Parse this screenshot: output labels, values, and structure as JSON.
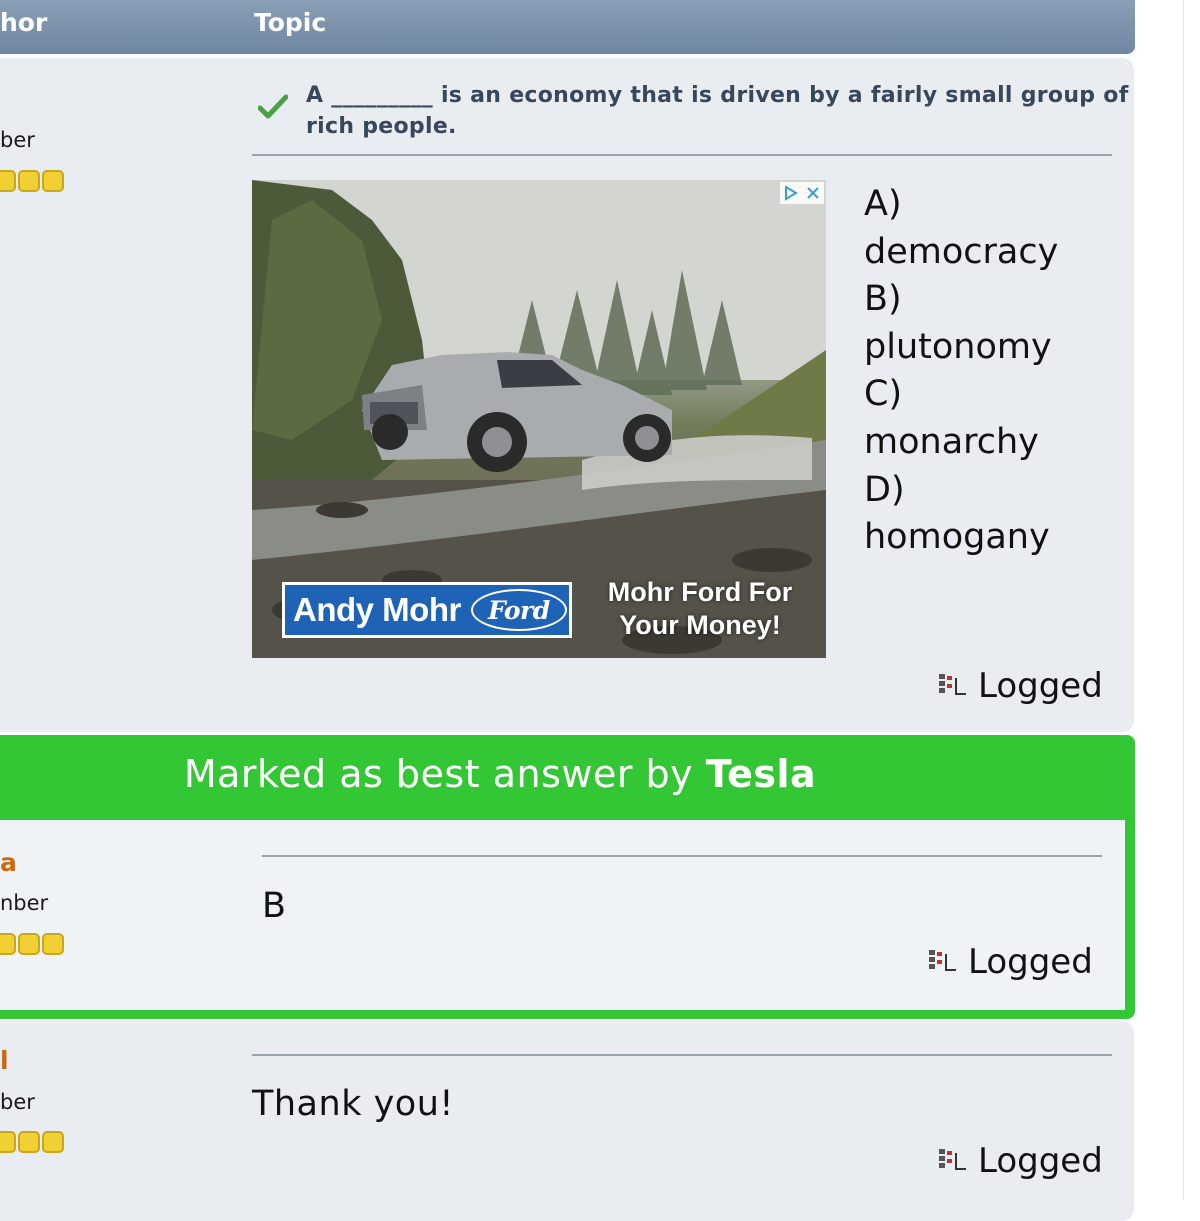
{
  "header": {
    "author_label": "hor",
    "topic_label": "Topic"
  },
  "post1": {
    "poster_role": "ber",
    "subject": "A _________ is an economy that is driven by a fairly small group of rich people.",
    "ad": {
      "brand_badge": "Andy Mohr",
      "ford_logo": "Ford",
      "tagline": "Mohr Ford For Your Money!"
    },
    "answers": [
      "A)",
      "democracy",
      "B)",
      "plutonomy",
      "C)",
      "monarchy",
      "D)",
      "homogany"
    ],
    "logged": "Logged"
  },
  "best_answer": {
    "title_prefix": "Marked as best answer by",
    "marked_by": "Tesla",
    "poster_name": "a",
    "poster_role": "nber",
    "body": "B",
    "logged": "Logged"
  },
  "post3": {
    "poster_name": "l",
    "poster_role": "ber",
    "body": "Thank you!",
    "logged": "Logged"
  },
  "colors": {
    "header": "#7690aa",
    "best_answer_green": "#34c735",
    "poster_name": "#c86a12",
    "star": "#f1d033"
  }
}
